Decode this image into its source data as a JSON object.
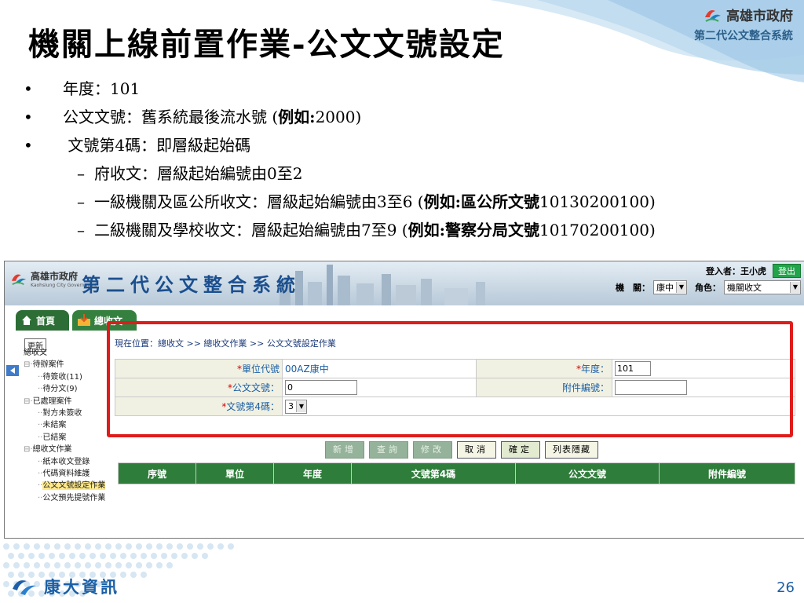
{
  "slide": {
    "title": "機關上線前置作業-公文文號設定",
    "bullets": [
      {
        "text": "年度：101"
      },
      {
        "text": "公文文號：舊系統最後流水號 (",
        "bold": "例如:",
        "tail": "2000)"
      },
      {
        "text": " 文號第4碼：即層級起始碼"
      }
    ],
    "subbullets": [
      {
        "text": "府收文：層級起始編號由0至2"
      },
      {
        "text": "一級機關及區公所收文：層級起始編號由3至6 (",
        "bold": "例如:區公所文號",
        "tail": "10130200100)"
      },
      {
        "text": "二級機關及學校收文：層級起始編號由7至9 (",
        "bold": "例如:警察分局文號",
        "tail": "10170200100)"
      }
    ],
    "bullet_marker": "•",
    "dash_marker": "–",
    "page_number": "26"
  },
  "brand": {
    "gov_name": "高雄市政府",
    "gov_sub": "Kaohsiung City Government",
    "system_name": "第二代公文整合系統",
    "footer_company": "康大資訊"
  },
  "app": {
    "logo_name": "高雄市政府",
    "logo_sub": "Kaohsiung City Government",
    "title": "第二代公文整合系統",
    "user_label": "登入者：",
    "user_name": "王小虎",
    "logout_label": "登出",
    "org_label": "機　關：",
    "org_value": "康中",
    "role_label": "角色：",
    "role_value": "機關收文",
    "nav_home": "首頁",
    "nav_recv": "總收文",
    "update_label": "更新",
    "sidebar_root": "總收文",
    "tree": [
      {
        "label": "待辦案件",
        "level": 1,
        "prefix": "⊟·"
      },
      {
        "label": "待簽收(11)",
        "level": 2,
        "prefix": "··"
      },
      {
        "label": "待分文(9)",
        "level": 2,
        "prefix": "··"
      },
      {
        "label": "已處理案件",
        "level": 1,
        "prefix": "⊟·"
      },
      {
        "label": "對方未簽收",
        "level": 2,
        "prefix": "··"
      },
      {
        "label": "未結案",
        "level": 2,
        "prefix": "··"
      },
      {
        "label": "已結案",
        "level": 2,
        "prefix": "··"
      },
      {
        "label": "總收文作業",
        "level": 1,
        "prefix": "⊟·"
      },
      {
        "label": "紙本收文登錄",
        "level": 2,
        "prefix": "··"
      },
      {
        "label": "代碼資料維護",
        "level": 2,
        "prefix": "··"
      },
      {
        "label": "公文文號設定作業",
        "level": 2,
        "prefix": "··",
        "selected": true
      },
      {
        "label": "公文預先提號作業",
        "level": 2,
        "prefix": "··"
      }
    ],
    "breadcrumb": "現在位置：總收文 >> 總收文作業 >> 公文文號設定作業",
    "form": {
      "unit_label": "單位代號",
      "unit_value": "00AZ康中",
      "year_label": "年度",
      "year_value": "101",
      "doc_no_label": "公文文號",
      "doc_no_value": "0",
      "attach_label": "附件編號",
      "attach_value": "",
      "fourth_label": "文號第4碼",
      "fourth_value": "3",
      "colon": "："
    },
    "buttons": {
      "add": "新增",
      "query": "查詢",
      "modify": "修改",
      "cancel": "取消",
      "confirm": "確定",
      "toggle_list": "列表隱藏"
    },
    "grid_headers": [
      "序號",
      "單位",
      "年度",
      "文號第4碼",
      "公文文號",
      "附件編號"
    ],
    "colors": {
      "accent_green": "#2e7d3a",
      "highlight_red": "#e01b1b",
      "title_blue": "#1b4f8e"
    }
  }
}
